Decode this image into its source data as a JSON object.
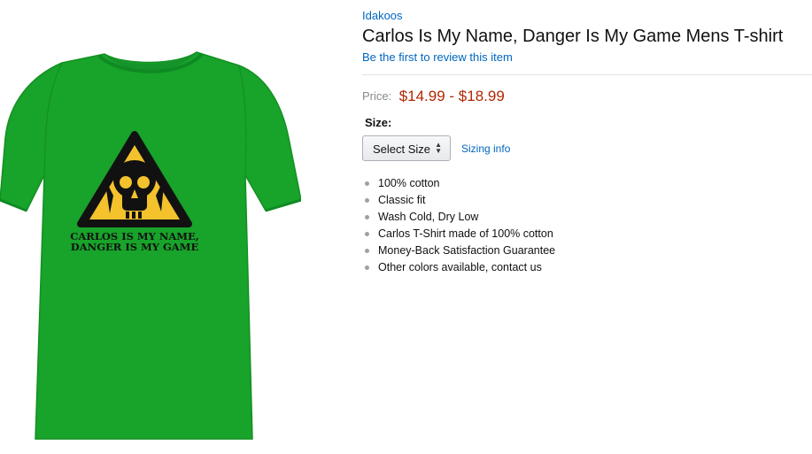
{
  "product": {
    "brand": "Idakoos",
    "title": "Carlos Is My Name, Danger Is My Game Mens T-shirt",
    "review_link": "Be the first to review this item",
    "image": {
      "shirt_color": "#18a32a",
      "shirt_text_line1": "CARLOS IS MY NAME,",
      "shirt_text_line2": "DANGER IS MY GAME"
    }
  },
  "price": {
    "label": "Price:",
    "value": "$14.99 - $18.99",
    "color": "#b12704"
  },
  "size": {
    "label": "Size:",
    "select_value": "Select Size",
    "sizing_link": "Sizing info"
  },
  "features": [
    "100% cotton",
    "Classic fit",
    "Wash Cold, Dry Low",
    "Carlos T-Shirt made of 100% cotton",
    "Money-Back Satisfaction Guarantee",
    "Other colors available, contact us"
  ],
  "colors": {
    "link": "#0066c0",
    "warning_yellow": "#f3c22d"
  }
}
